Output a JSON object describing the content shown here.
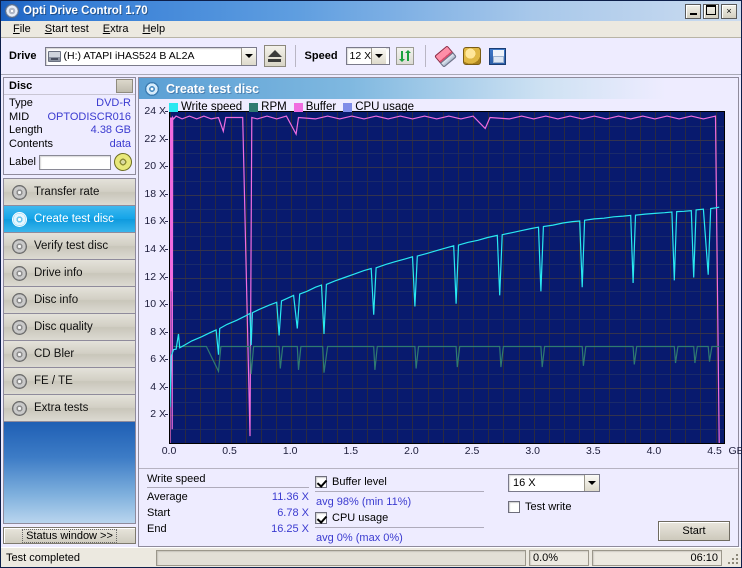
{
  "window": {
    "title": "Opti Drive Control 1.70",
    "icon": "disc-icon",
    "minimize": "minimize-icon",
    "maximize": "maximize-icon",
    "close": "×"
  },
  "menu": {
    "items": [
      {
        "label": "File"
      },
      {
        "label": "Start test"
      },
      {
        "label": "Extra"
      },
      {
        "label": "Help"
      }
    ]
  },
  "toolbar": {
    "drive_label": "Drive",
    "drive_value": "(H:)  ATAPI iHAS524  B AL2A",
    "eject": "eject-icon",
    "speed_label": "Speed",
    "speed_value": "12 X",
    "refresh": "refresh-icon",
    "erase": "eraser-icon",
    "gold": "hand-icon",
    "save": "save-icon"
  },
  "disc": {
    "header": "Disc",
    "rows": [
      {
        "key": "Type",
        "value": "DVD-R"
      },
      {
        "key": "MID",
        "value": "OPTODISCR016"
      },
      {
        "key": "Length",
        "value": "4.38 GB"
      },
      {
        "key": "Contents",
        "value": "data"
      }
    ],
    "label_key": "Label",
    "label_value": ""
  },
  "sidebar": {
    "items": [
      {
        "label": "Transfer rate",
        "selected": false
      },
      {
        "label": "Create test disc",
        "selected": true
      },
      {
        "label": "Verify test disc",
        "selected": false
      },
      {
        "label": "Drive info",
        "selected": false
      },
      {
        "label": "Disc info",
        "selected": false
      },
      {
        "label": "Disc quality",
        "selected": false
      },
      {
        "label": "CD Bler",
        "selected": false
      },
      {
        "label": "FE / TE",
        "selected": false
      },
      {
        "label": "Extra tests",
        "selected": false
      }
    ],
    "status_window": "Status window >>"
  },
  "panel": {
    "title": "Create test disc"
  },
  "chart_data": {
    "type": "line",
    "title": "Create test disc",
    "xlabel": "GB",
    "ylabel": "X",
    "xlim": [
      0.0,
      4.57
    ],
    "ylim": [
      0,
      24
    ],
    "grid": true,
    "legend_position": "top-left",
    "x_ticks": [
      "0.0",
      "0.5",
      "1.0",
      "1.5",
      "2.0",
      "2.5",
      "3.0",
      "3.5",
      "4.0",
      "4.5"
    ],
    "x_tick_values": [
      0.0,
      0.5,
      1.0,
      1.5,
      2.0,
      2.5,
      3.0,
      3.5,
      4.0,
      4.5
    ],
    "x_unit": "GB",
    "y_ticks": [
      "2 X",
      "4 X",
      "6 X",
      "8 X",
      "10 X",
      "12 X",
      "14 X",
      "16 X",
      "18 X",
      "20 X",
      "22 X",
      "24 X"
    ],
    "y_tick_values": [
      2,
      4,
      6,
      8,
      10,
      12,
      14,
      16,
      18,
      20,
      22,
      24
    ],
    "plot_bg": "#081a6e",
    "series": [
      {
        "name": "Write speed",
        "color": "#29e8f0",
        "points": [
          [
            0.0,
            2.6
          ],
          [
            0.01,
            6.3
          ],
          [
            0.03,
            6.78
          ],
          [
            0.05,
            6.8
          ],
          [
            0.07,
            7.9
          ],
          [
            0.08,
            6.9
          ],
          [
            0.12,
            7.1
          ],
          [
            0.18,
            7.4
          ],
          [
            0.26,
            7.7
          ],
          [
            0.33,
            8.0
          ],
          [
            0.38,
            8.2
          ],
          [
            0.4,
            6.4
          ],
          [
            0.41,
            8.3
          ],
          [
            0.47,
            8.6
          ],
          [
            0.55,
            8.9
          ],
          [
            0.62,
            9.2
          ],
          [
            0.66,
            9.4
          ],
          [
            0.67,
            7.1
          ],
          [
            0.68,
            9.45
          ],
          [
            0.74,
            9.7
          ],
          [
            0.82,
            10.0
          ],
          [
            0.88,
            10.2
          ],
          [
            0.9,
            7.8
          ],
          [
            0.92,
            10.3
          ],
          [
            0.97,
            10.5
          ],
          [
            1.02,
            10.7
          ],
          [
            1.05,
            8.3
          ],
          [
            1.07,
            10.8
          ],
          [
            1.13,
            11.0
          ],
          [
            1.2,
            11.3
          ],
          [
            1.25,
            11.45
          ],
          [
            1.27,
            7.9
          ],
          [
            1.29,
            11.5
          ],
          [
            1.36,
            11.75
          ],
          [
            1.44,
            12.0
          ],
          [
            1.52,
            12.25
          ],
          [
            1.6,
            12.5
          ],
          [
            1.66,
            12.65
          ],
          [
            1.68,
            9.3
          ],
          [
            1.7,
            12.7
          ],
          [
            1.78,
            12.95
          ],
          [
            1.86,
            13.15
          ],
          [
            1.94,
            13.35
          ],
          [
            2.0,
            13.5
          ],
          [
            2.02,
            9.9
          ],
          [
            2.04,
            13.55
          ],
          [
            2.12,
            13.75
          ],
          [
            2.2,
            13.95
          ],
          [
            2.28,
            14.15
          ],
          [
            2.34,
            14.3
          ],
          [
            2.36,
            10.1
          ],
          [
            2.38,
            14.35
          ],
          [
            2.46,
            14.55
          ],
          [
            2.54,
            14.7
          ],
          [
            2.62,
            14.9
          ],
          [
            2.7,
            15.05
          ],
          [
            2.72,
            10.7
          ],
          [
            2.74,
            15.1
          ],
          [
            2.82,
            15.25
          ],
          [
            2.9,
            15.4
          ],
          [
            2.98,
            15.55
          ],
          [
            3.04,
            15.65
          ],
          [
            3.06,
            11.0
          ],
          [
            3.08,
            15.7
          ],
          [
            3.16,
            15.8
          ],
          [
            3.24,
            15.95
          ],
          [
            3.32,
            16.05
          ],
          [
            3.38,
            16.1
          ],
          [
            3.4,
            11.3
          ],
          [
            3.42,
            16.15
          ],
          [
            3.5,
            16.25
          ],
          [
            3.58,
            16.3
          ],
          [
            3.66,
            16.4
          ],
          [
            3.74,
            16.45
          ],
          [
            3.8,
            16.5
          ],
          [
            3.82,
            11.6
          ],
          [
            3.84,
            16.52
          ],
          [
            3.92,
            16.6
          ],
          [
            4.0,
            16.65
          ],
          [
            4.08,
            16.7
          ],
          [
            4.14,
            16.75
          ],
          [
            4.16,
            11.8
          ],
          [
            4.18,
            16.78
          ],
          [
            4.24,
            16.8
          ],
          [
            4.3,
            16.85
          ],
          [
            4.32,
            12.0
          ],
          [
            4.34,
            16.9
          ],
          [
            4.4,
            16.95
          ],
          [
            4.44,
            12.2
          ],
          [
            4.46,
            17.0
          ],
          [
            4.5,
            17.05
          ],
          [
            4.53,
            17.1
          ]
        ]
      },
      {
        "name": "RPM",
        "color": "#2f7a70",
        "points": [
          [
            0.03,
            7.0
          ],
          [
            0.3,
            7.0
          ],
          [
            0.4,
            5.2
          ],
          [
            0.42,
            7.0
          ],
          [
            0.66,
            7.0
          ],
          [
            0.67,
            5.0
          ],
          [
            0.69,
            7.0
          ],
          [
            0.9,
            7.0
          ],
          [
            0.91,
            5.4
          ],
          [
            0.93,
            7.0
          ],
          [
            1.05,
            7.0
          ],
          [
            1.06,
            5.3
          ],
          [
            1.08,
            7.0
          ],
          [
            1.26,
            7.0
          ],
          [
            1.27,
            5.1
          ],
          [
            1.3,
            7.0
          ],
          [
            1.68,
            7.0
          ],
          [
            1.69,
            5.3
          ],
          [
            1.71,
            7.0
          ],
          [
            2.02,
            7.0
          ],
          [
            2.03,
            5.4
          ],
          [
            2.05,
            7.0
          ],
          [
            2.36,
            7.0
          ],
          [
            2.37,
            5.5
          ],
          [
            2.39,
            7.0
          ],
          [
            2.72,
            7.0
          ],
          [
            2.73,
            5.5
          ],
          [
            2.75,
            7.0
          ],
          [
            3.06,
            7.0
          ],
          [
            3.07,
            5.5
          ],
          [
            3.09,
            7.0
          ],
          [
            3.4,
            7.0
          ],
          [
            3.41,
            5.6
          ],
          [
            3.43,
            7.0
          ],
          [
            3.82,
            7.0
          ],
          [
            3.83,
            5.7
          ],
          [
            3.85,
            7.0
          ],
          [
            4.16,
            7.0
          ],
          [
            4.17,
            5.8
          ],
          [
            4.19,
            7.0
          ],
          [
            4.32,
            7.0
          ],
          [
            4.33,
            5.8
          ],
          [
            4.35,
            7.0
          ],
          [
            4.44,
            7.0
          ],
          [
            4.45,
            5.9
          ],
          [
            4.47,
            7.0
          ],
          [
            4.53,
            7.0
          ]
        ]
      },
      {
        "name": "Buffer",
        "color": "#f06ce0",
        "points": [
          [
            0.0,
            0.0
          ],
          [
            0.005,
            23.6
          ],
          [
            0.01,
            11.0
          ],
          [
            0.012,
            23.6
          ],
          [
            0.018,
            1.0
          ],
          [
            0.022,
            23.6
          ],
          [
            0.03,
            23.5
          ],
          [
            0.05,
            23.7
          ],
          [
            0.1,
            23.5
          ],
          [
            0.16,
            23.7
          ],
          [
            0.22,
            23.5
          ],
          [
            0.28,
            23.7
          ],
          [
            0.34,
            23.5
          ],
          [
            0.4,
            23.6
          ],
          [
            0.44,
            22.6
          ],
          [
            0.46,
            23.6
          ],
          [
            0.6,
            23.6
          ],
          [
            0.66,
            0.5
          ],
          [
            0.675,
            23.6
          ],
          [
            0.72,
            23.5
          ],
          [
            0.8,
            23.7
          ],
          [
            0.88,
            23.5
          ],
          [
            0.96,
            23.7
          ],
          [
            1.04,
            22.4
          ],
          [
            1.06,
            23.6
          ],
          [
            1.2,
            23.5
          ],
          [
            1.3,
            23.7
          ],
          [
            1.4,
            23.5
          ],
          [
            1.5,
            23.7
          ],
          [
            1.6,
            23.5
          ],
          [
            1.7,
            23.7
          ],
          [
            1.8,
            23.5
          ],
          [
            1.9,
            23.7
          ],
          [
            2.0,
            23.5
          ],
          [
            2.1,
            23.7
          ],
          [
            2.2,
            23.5
          ],
          [
            2.3,
            23.7
          ],
          [
            2.4,
            23.5
          ],
          [
            2.5,
            23.7
          ],
          [
            2.6,
            22.8
          ],
          [
            2.64,
            23.6
          ],
          [
            2.8,
            23.5
          ],
          [
            2.9,
            23.7
          ],
          [
            3.0,
            23.5
          ],
          [
            3.1,
            23.7
          ],
          [
            3.2,
            23.5
          ],
          [
            3.3,
            23.7
          ],
          [
            3.4,
            23.5
          ],
          [
            3.5,
            23.7
          ],
          [
            3.6,
            23.5
          ],
          [
            3.7,
            23.7
          ],
          [
            3.8,
            23.5
          ],
          [
            3.9,
            23.7
          ],
          [
            4.0,
            23.5
          ],
          [
            4.1,
            23.7
          ],
          [
            4.2,
            23.5
          ],
          [
            4.3,
            23.7
          ],
          [
            4.4,
            23.5
          ],
          [
            4.5,
            23.7
          ],
          [
            4.53,
            0.0
          ]
        ]
      },
      {
        "name": "CPU usage",
        "color": "#7f8ce8",
        "points": []
      }
    ],
    "legend": [
      {
        "label": "Write speed",
        "color": "#29e8f0"
      },
      {
        "label": "RPM",
        "color": "#2f7a70"
      },
      {
        "label": "Buffer",
        "color": "#f06ce0"
      },
      {
        "label": "CPU usage",
        "color": "#7f8ce8"
      }
    ]
  },
  "stats": {
    "write_speed_title": "Write speed",
    "rows": [
      {
        "key": "Average",
        "value": "11.36 X"
      },
      {
        "key": "Start",
        "value": "6.78 X"
      },
      {
        "key": "End",
        "value": "16.25 X"
      }
    ],
    "buffer_level_label": "Buffer level",
    "buffer_level_checked": true,
    "buffer_avg": "avg 98% (min 11%)",
    "cpu_usage_label": "CPU usage",
    "cpu_usage_checked": true,
    "cpu_avg": "avg 0% (max 0%)",
    "speed_select": "16 X",
    "test_write_label": "Test write",
    "test_write_checked": false,
    "start_button": "Start"
  },
  "statusbar": {
    "message": "Test completed",
    "progress_percent": "0.0%",
    "progress_value": 0,
    "elapsed": "06:10"
  }
}
